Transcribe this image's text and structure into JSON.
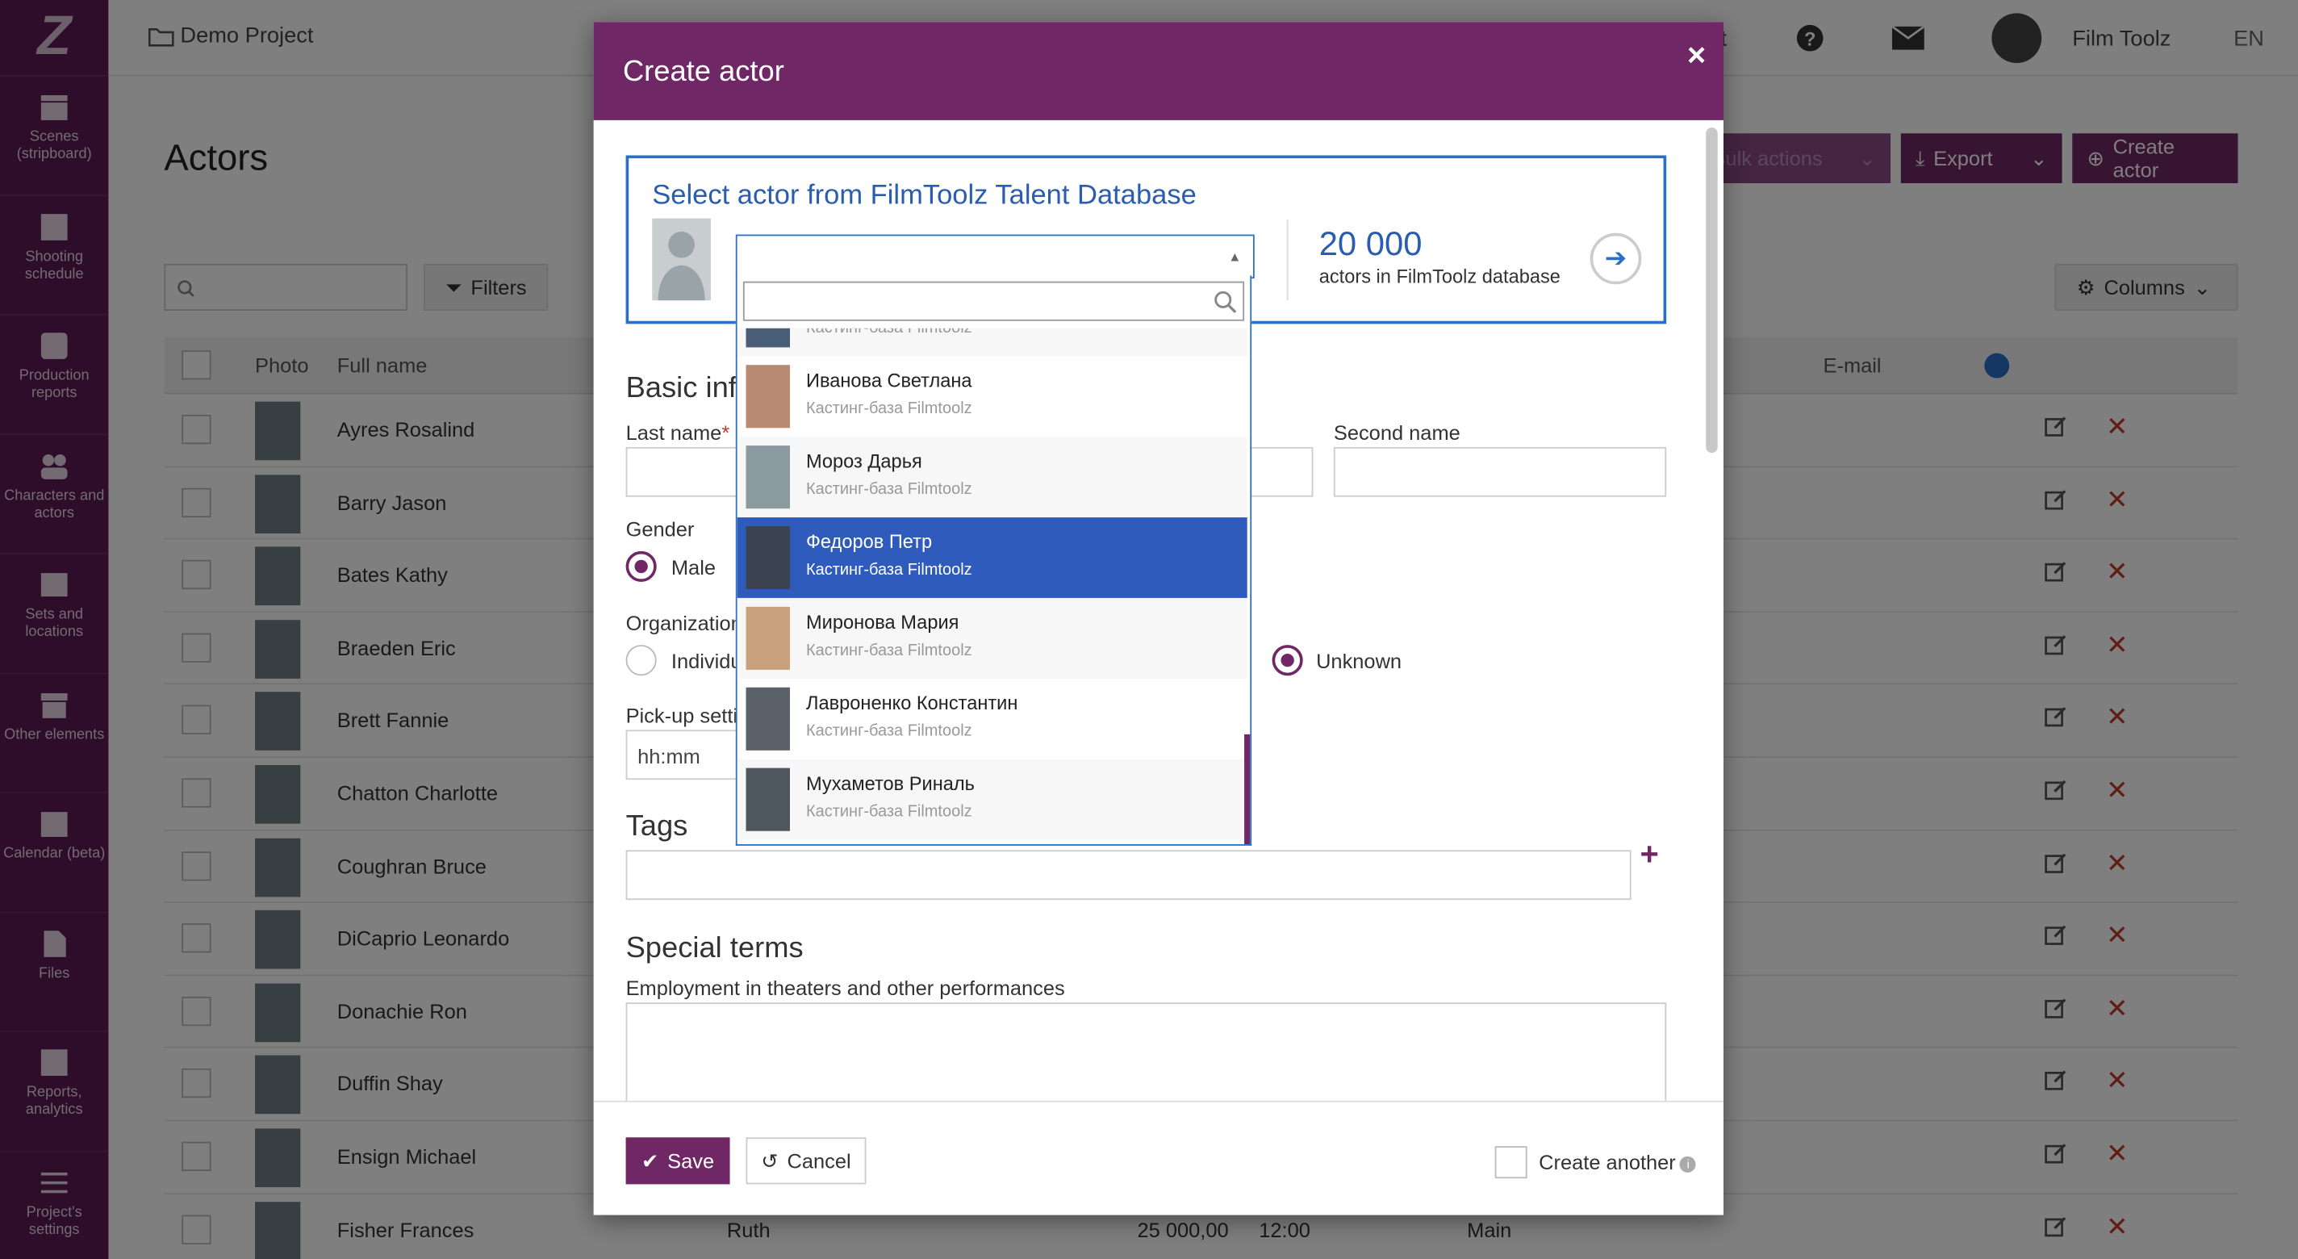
{
  "sidebar": {
    "logo": "Z",
    "items": [
      {
        "label": "Scenes (stripboard)",
        "icon": "clapperboard-icon"
      },
      {
        "label": "Shooting schedule",
        "icon": "calendar-icon"
      },
      {
        "label": "Production reports",
        "icon": "checkbox-icon"
      },
      {
        "label": "Characters and actors",
        "icon": "people-icon"
      },
      {
        "label": "Sets and locations",
        "icon": "image-icon"
      },
      {
        "label": "Other elements",
        "icon": "box-icon"
      },
      {
        "label": "Calendar (beta)",
        "icon": "calendar-grid-icon"
      },
      {
        "label": "Files",
        "icon": "file-icon"
      },
      {
        "label": "Reports, analytics",
        "icon": "bar-chart-icon"
      },
      {
        "label": "Project's settings",
        "icon": "sliders-icon"
      }
    ]
  },
  "topbar": {
    "project": "Demo Project",
    "partial": "t",
    "user": "Film Toolz",
    "lang": "EN"
  },
  "page": {
    "title": "Actors",
    "bulk_actions": "Bulk actions",
    "export": "Export",
    "create_actor": "Create actor",
    "filters": "Filters",
    "columns": "Columns"
  },
  "table": {
    "headers": {
      "photo": "Photo",
      "full_name": "Full name",
      "email": "E-mail"
    },
    "rows": [
      "Ayres Rosalind",
      "Barry Jason",
      "Bates Kathy",
      "Braeden Eric",
      "Brett Fannie",
      "Chatton Charlotte",
      "Coughran Bruce",
      "DiCaprio Leonardo",
      "Donachie Ron",
      "Duffin Shay",
      "Ensign Michael",
      "Fisher Frances"
    ],
    "last_row_extra": {
      "role": "Ruth",
      "fee": "25 000,00",
      "time": "12:00",
      "type": "Main"
    }
  },
  "modal": {
    "title": "Create actor",
    "close": "×",
    "talent": {
      "title": "Select actor from FilmToolz Talent Database",
      "count": "20 000",
      "count_sub": "actors in FilmToolz database"
    },
    "basic_info": "Basic inf",
    "last_name": "Last name",
    "required_mark": "*",
    "second_name": "Second name",
    "gender": "Gender",
    "male": "Male",
    "organization": "Organization",
    "individual": "Individu",
    "unknown": "Unknown",
    "pickup": "Pick-up setti",
    "pickup_placeholder": "hh:mm",
    "tags": "Tags",
    "special_terms": "Special terms",
    "employment": "Employment in theaters and other performances",
    "save": "Save",
    "cancel": "Cancel",
    "create_another": "Create another"
  },
  "dropdown": {
    "partial_sub": "Кастинг-база Filmtoolz",
    "options": [
      {
        "name": "Иванова Светлана",
        "sub": "Кастинг-база Filmtoolz",
        "selected": false
      },
      {
        "name": "Мороз Дарья",
        "sub": "Кастинг-база Filmtoolz",
        "selected": false
      },
      {
        "name": "Федоров Петр",
        "sub": "Кастинг-база Filmtoolz",
        "selected": true
      },
      {
        "name": "Миронова Мария",
        "sub": "Кастинг-база Filmtoolz",
        "selected": false
      },
      {
        "name": "Лавроненко Константин",
        "sub": "Кастинг-база Filmtoolz",
        "selected": false
      },
      {
        "name": "Мухаметов Риналь",
        "sub": "Кастинг-база Filmtoolz",
        "selected": false
      }
    ]
  },
  "colors": {
    "brand": "#6f2865",
    "accent": "#2a6fc9",
    "selected": "#2f5bbd",
    "danger": "#c0392b"
  }
}
